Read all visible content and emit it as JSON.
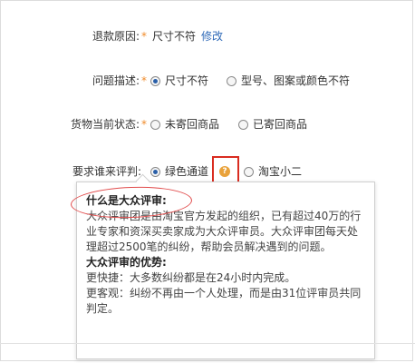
{
  "refund_reason": {
    "label": "退款原因:",
    "required_mark": "*",
    "value": "尺寸不符",
    "edit_link": "修改"
  },
  "problem_description": {
    "label": "问题描述:",
    "required_mark": "*",
    "options": [
      {
        "label": "尺寸不符",
        "checked": true
      },
      {
        "label": "型号、图案或颜色不符",
        "checked": false
      }
    ]
  },
  "goods_status": {
    "label": "货物当前状态:",
    "required_mark": "*",
    "options": [
      {
        "label": "未寄回商品",
        "checked": false
      },
      {
        "label": "已寄回商品",
        "checked": false
      }
    ]
  },
  "judge": {
    "label": "要求谁来评判:",
    "options": [
      {
        "label": "绿色通道",
        "checked": true
      },
      {
        "label": "淘宝小二",
        "checked": false
      }
    ],
    "help_icon": "question-icon"
  },
  "tooltip": {
    "title": "什么是大众评审:",
    "intro": "大众评审团是由淘宝官方发起的组织，已有超过40万的行业专家和资深买卖家成为大众评审员。大众评审团每天处理超过2500笔的纠纷，帮助会员解决遇到的问题。",
    "adv_title": "大众评审的优势:",
    "adv1": "更快捷：大多数纠纷都是在24小时内完成。",
    "adv2": "更客观：纠纷不再由一个人处理，而是由31位评审员共同判定。"
  },
  "colors": {
    "required": "#f08c2c",
    "link": "#2f6ab8",
    "radio_checked": "#2a5fa8",
    "highlight_red": "#d92c20"
  }
}
